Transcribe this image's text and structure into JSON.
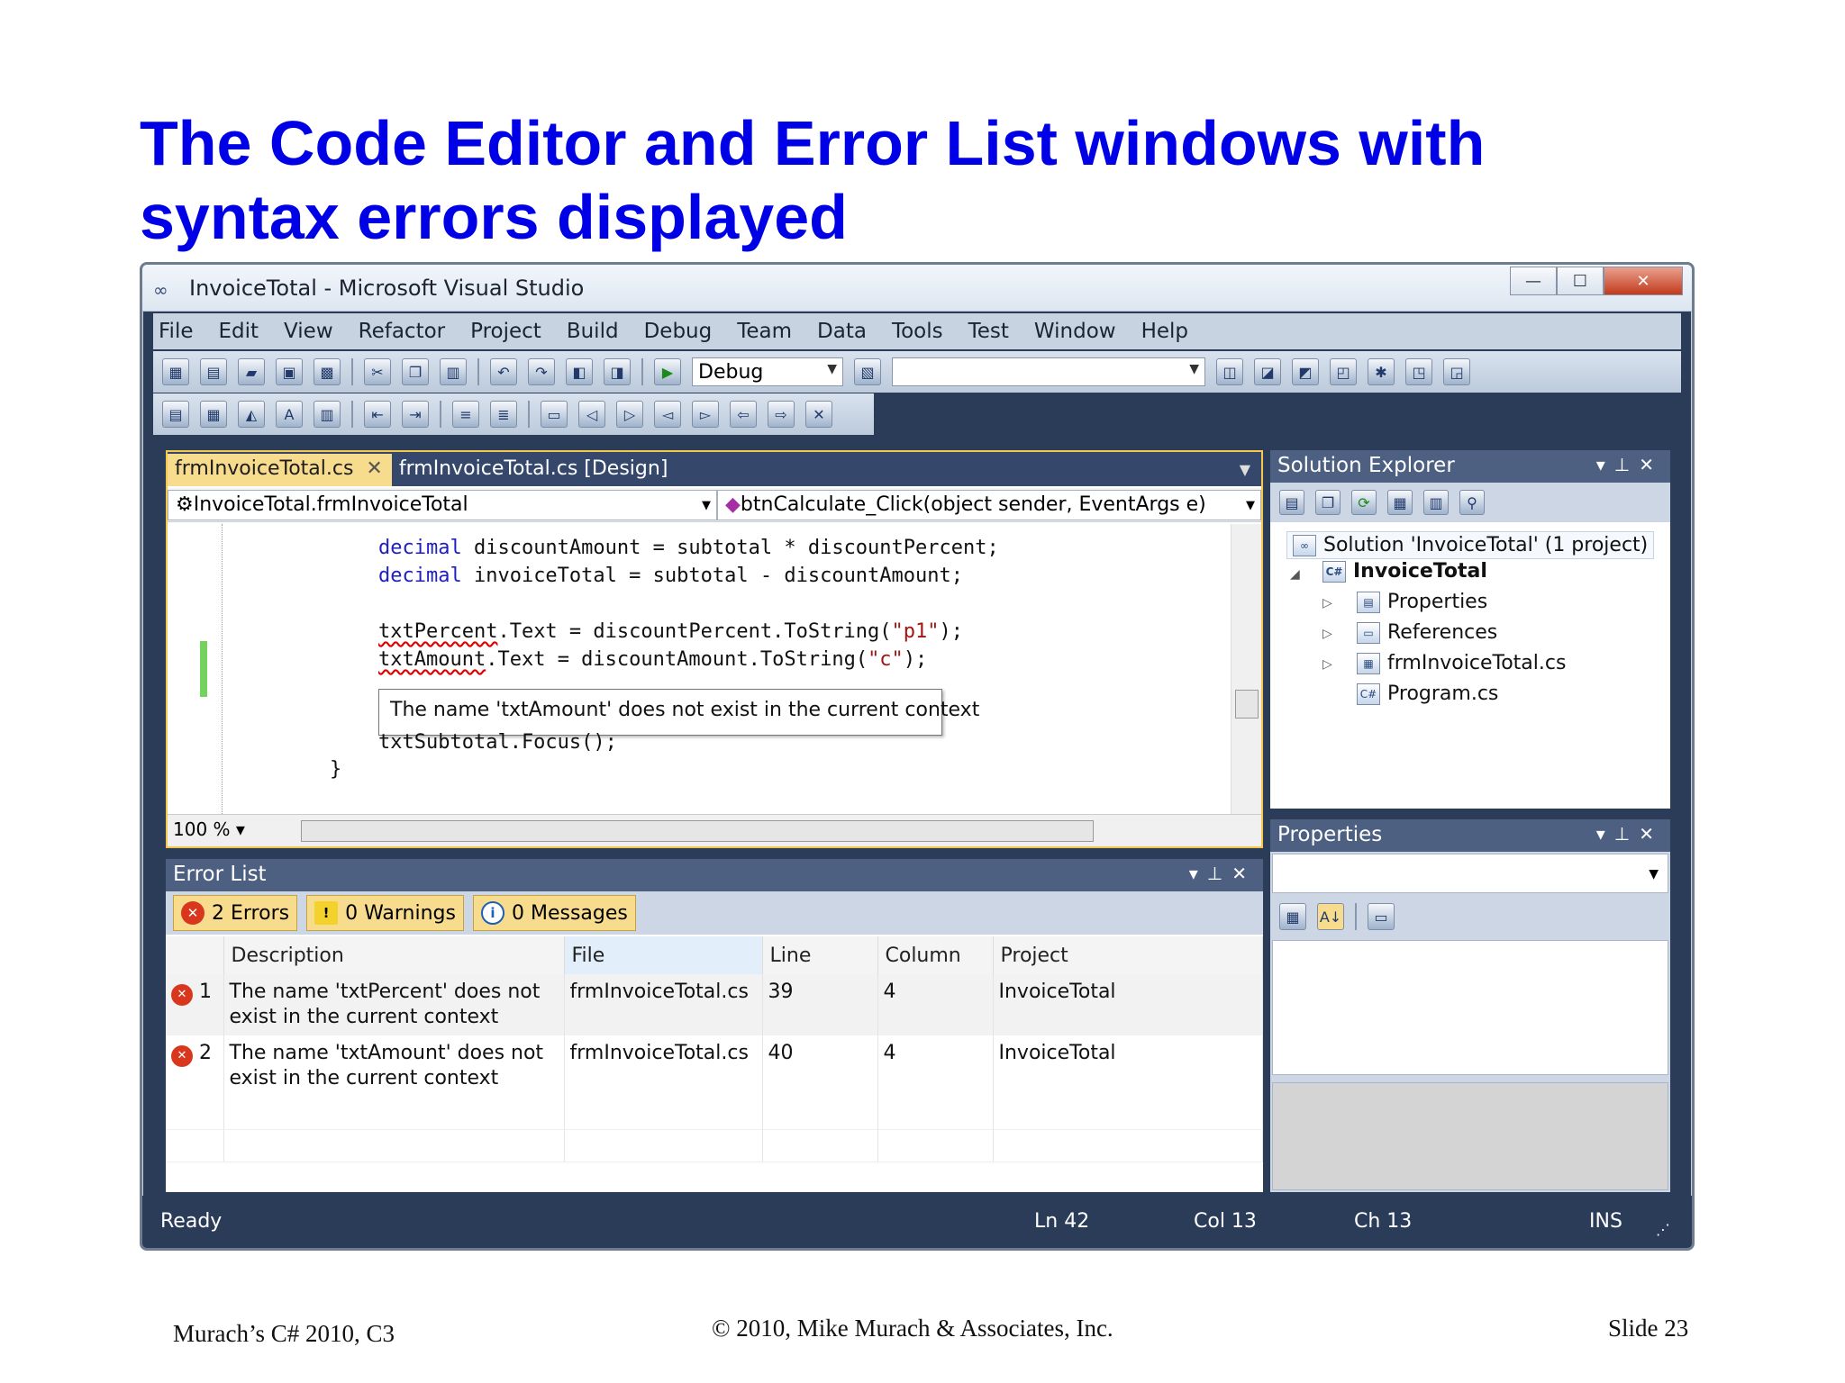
{
  "slide": {
    "title_line1": "The Code Editor and Error List windows with",
    "title_line2": "syntax errors displayed",
    "footer_left": "Murach’s C# 2010, C3",
    "footer_center": "© 2010, Mike Murach & Associates, Inc.",
    "footer_right": "Slide 23"
  },
  "window": {
    "title": "InvoiceTotal - Microsoft Visual Studio",
    "menu": [
      "File",
      "Edit",
      "View",
      "Refactor",
      "Project",
      "Build",
      "Debug",
      "Team",
      "Data",
      "Tools",
      "Test",
      "Window",
      "Help"
    ],
    "config_combo": "Debug",
    "search_combo": ""
  },
  "editor": {
    "tabs": [
      "frmInvoiceTotal.cs",
      "frmInvoiceTotal.cs [Design]"
    ],
    "class_combo": "InvoiceTotal.frmInvoiceTotal",
    "member_combo": "btnCalculate_Click(object sender, EventArgs e)",
    "lines": {
      "l1_kw": "decimal",
      "l1_rest": " discountAmount = subtotal * discountPercent;",
      "l2_kw": "decimal",
      "l2_rest": " invoiceTotal = subtotal - discountAmount;",
      "l3_err": "txtPercent",
      "l3_mid": ".Text = discountPercent.ToString(",
      "l3_str": "\"p1\"",
      "l3_end": ");",
      "l4_err": "txtAmount",
      "l4_mid": ".Text = discountAmount.ToString(",
      "l4_str": "\"c\"",
      "l4_end": ");",
      "l5": "txtSubtotal.Focus();",
      "l6": "}"
    },
    "tooltip": "The name 'txtAmount' does not exist in the current context",
    "zoom": "100 %"
  },
  "error_list": {
    "title": "Error List",
    "filters": {
      "errors": "2 Errors",
      "warnings": "0 Warnings",
      "messages": "0 Messages"
    },
    "columns": [
      "Description",
      "File",
      "Line",
      "Column",
      "Project"
    ],
    "rows": [
      {
        "num": "1",
        "description": "The name 'txtPercent' does not exist in the current context",
        "file": "frmInvoiceTotal.cs",
        "line": "39",
        "column": "4",
        "project": "InvoiceTotal"
      },
      {
        "num": "2",
        "description": "The name 'txtAmount' does not exist in the current context",
        "file": "frmInvoiceTotal.cs",
        "line": "40",
        "column": "4",
        "project": "InvoiceTotal"
      }
    ]
  },
  "solution_explorer": {
    "title": "Solution Explorer",
    "solution": "Solution 'InvoiceTotal' (1 project)",
    "project": "InvoiceTotal",
    "items": [
      "Properties",
      "References",
      "frmInvoiceTotal.cs",
      "Program.cs"
    ]
  },
  "properties": {
    "title": "Properties"
  },
  "status": {
    "state": "Ready",
    "ln": "Ln 42",
    "col": "Col 13",
    "ch": "Ch 13",
    "mode": "INS"
  },
  "colors": {
    "title": "#0000e6",
    "chrome": "#2b3c59",
    "active_tab": "#f7dc8e",
    "error": "#d8371e"
  }
}
